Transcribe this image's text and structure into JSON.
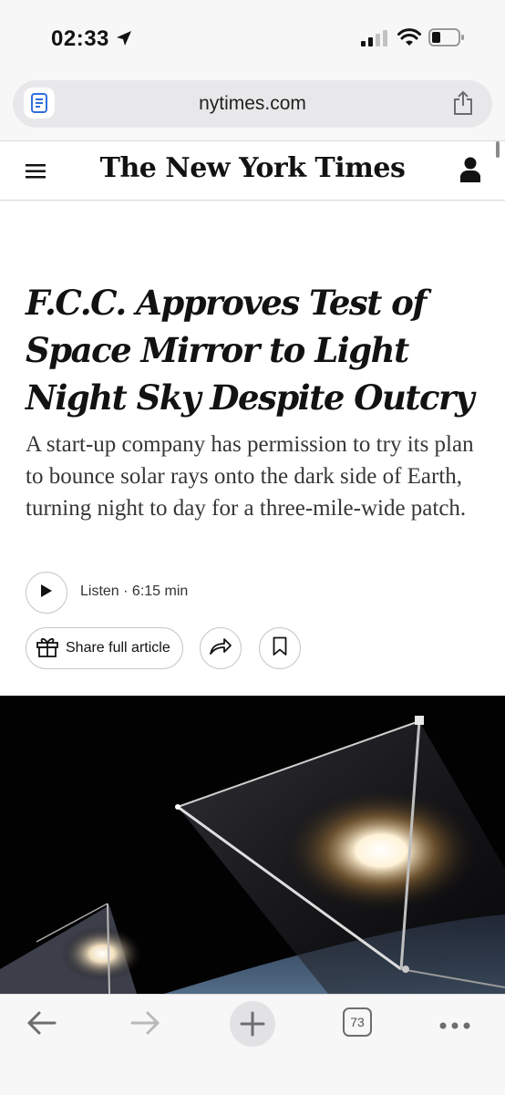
{
  "status_bar": {
    "time": "02:33"
  },
  "browser": {
    "url": "nytimes.com",
    "tab_count": "73"
  },
  "site": {
    "logo_text": "The New York Times"
  },
  "article": {
    "headline": "F.C.C. Approves Test of Space Mirror to Light Night Sky Despite Outcry",
    "summary": "A start-up company has permission to try its plan to bounce solar rays onto the dark side of Earth, turning night to day for a three-mile-wide patch.",
    "listen_label": "Listen · 6:15 min",
    "share_label": "Share full article"
  },
  "icons": [
    "location-arrow-icon",
    "signal-icon",
    "wifi-icon",
    "battery-icon",
    "reader-icon",
    "share-icon",
    "menu-icon",
    "account-icon",
    "play-icon",
    "gift-icon",
    "forward-share-icon",
    "bookmark-icon",
    "back-icon",
    "forward-icon",
    "new-tab-icon",
    "more-icon"
  ],
  "colors": {
    "text": "#121212",
    "summary": "#363636",
    "chrome": "#f7f7f7",
    "accent_reader": "#2f6fdc"
  }
}
